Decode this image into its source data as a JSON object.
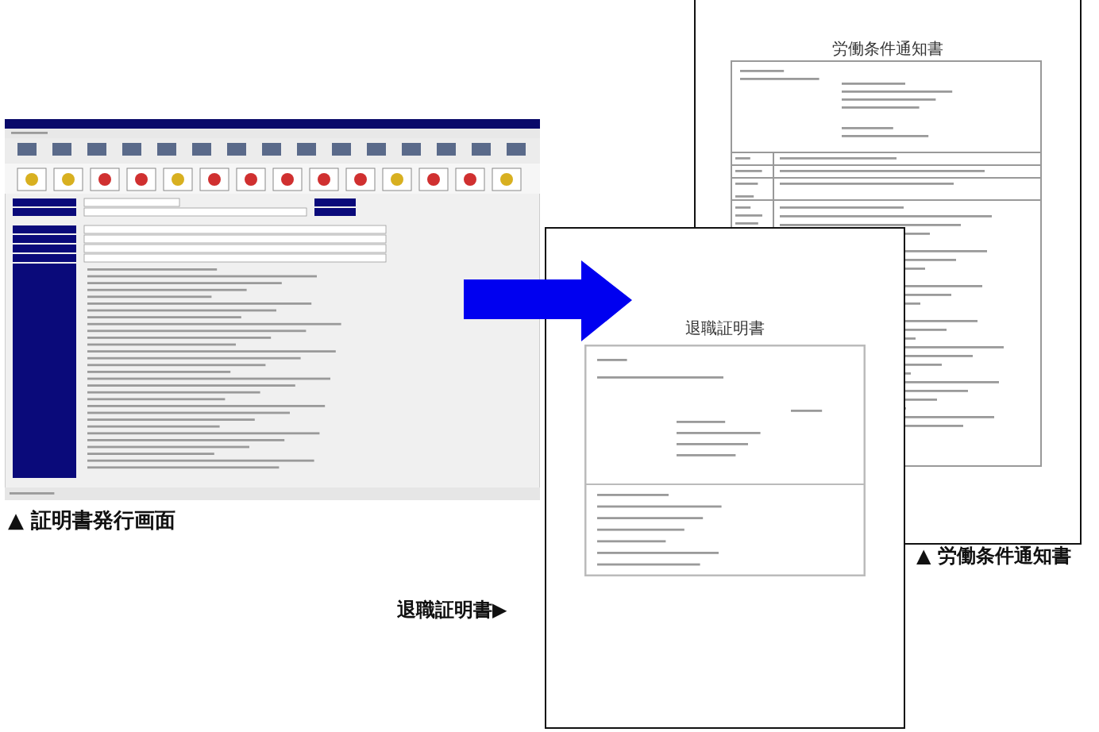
{
  "documents": [
    {
      "title": "労働条件通知書"
    },
    {
      "title": "退職証明書"
    }
  ],
  "captions": [
    {
      "text": "▲ 証明書発行画面"
    },
    {
      "text": "退職証明書▶"
    },
    {
      "text": "▲ 労働条件通知書"
    }
  ]
}
